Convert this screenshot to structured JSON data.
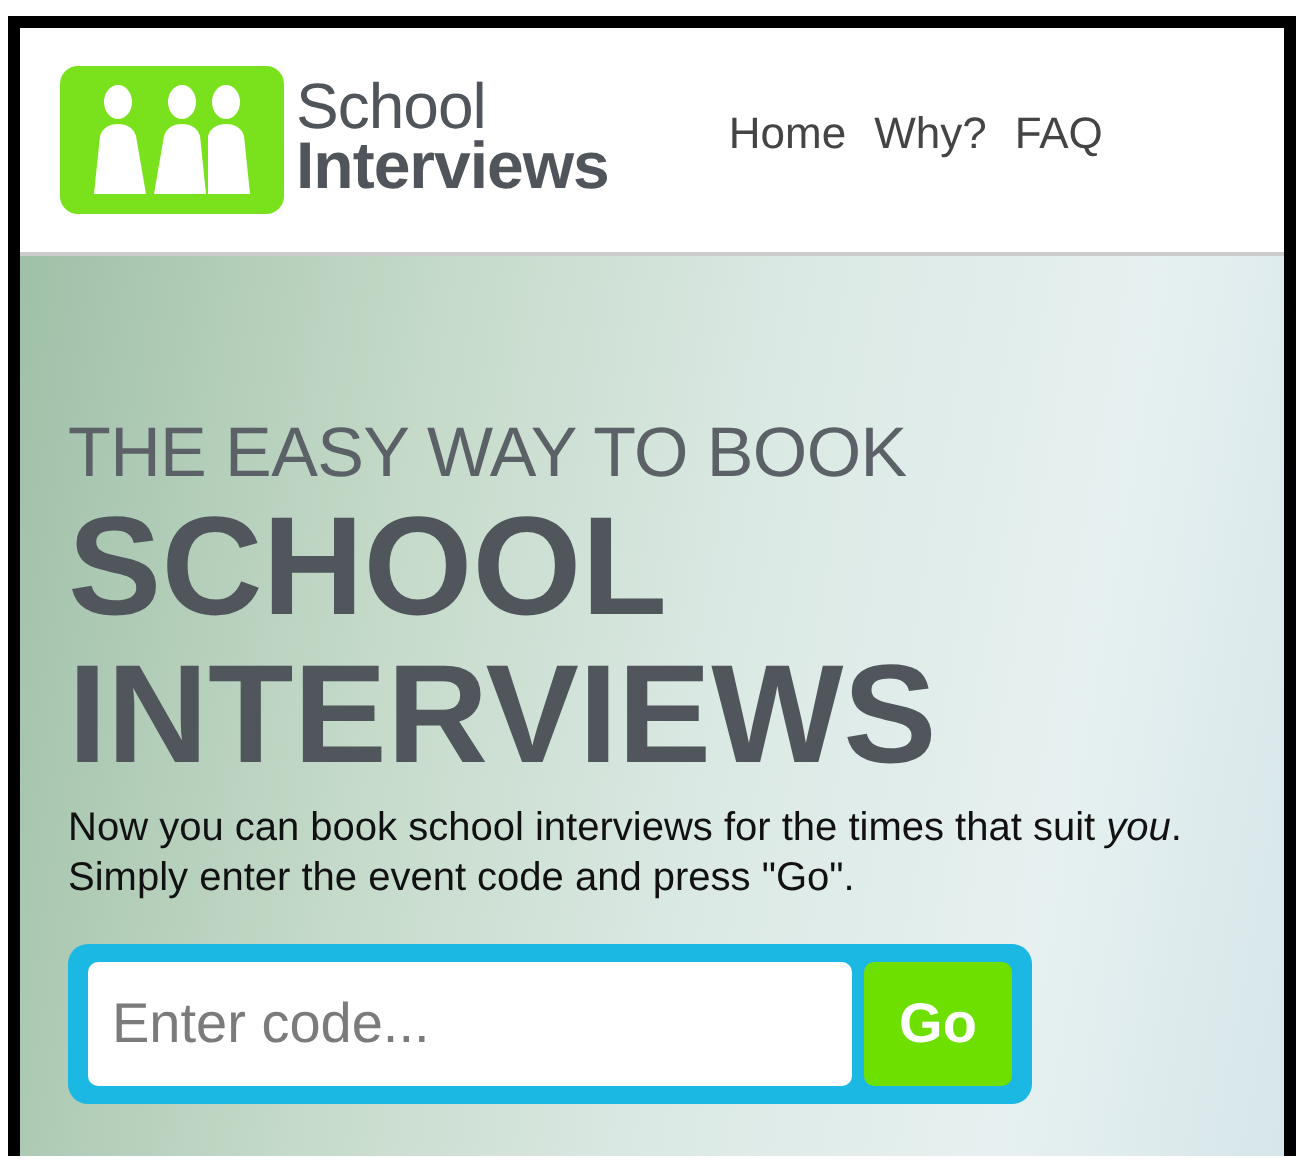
{
  "logo": {
    "line_1": "School",
    "line_2": "Interviews"
  },
  "nav": [
    {
      "label": "Home"
    },
    {
      "label": "Why?"
    },
    {
      "label": "FAQ"
    }
  ],
  "hero": {
    "kicker": "THE EASY WAY TO BOOK",
    "title_1": "SCHOOL",
    "title_2": "INTERVIEWS",
    "text": "Now you can book school interviews for the times that suit *you*. Simply enter the event code and press \"Go\"."
  },
  "code_form": {
    "placeholder": "Enter code...",
    "button": "Go"
  }
}
